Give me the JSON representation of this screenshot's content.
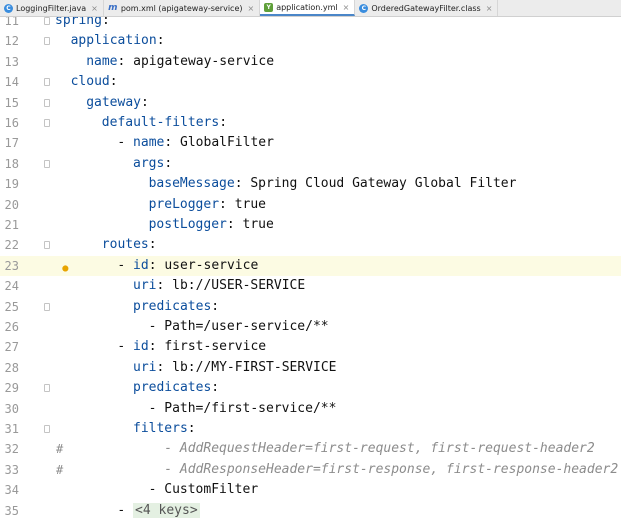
{
  "tabs": [
    {
      "label": "LoggingFilter.java",
      "icon": "java-class-icon",
      "active": false
    },
    {
      "label": "pom.xml (apigateway-service)",
      "icon": "maven-icon",
      "active": false
    },
    {
      "label": "application.yml",
      "icon": "yaml-file-icon",
      "active": true
    },
    {
      "label": "OrderedGatewayFilter.class",
      "icon": "java-class-icon",
      "active": false
    }
  ],
  "tab_close": "×",
  "accent": "#4a86c8",
  "key_color": "#0b4d9c",
  "comment_color": "#8c8c8c",
  "caret_line": 23,
  "lines": [
    {
      "num": "11",
      "indent": 0,
      "key": "spring",
      "sep": ":",
      "val": ""
    },
    {
      "num": "12",
      "indent": 1,
      "key": "application",
      "sep": ":",
      "val": ""
    },
    {
      "num": "13",
      "indent": 2,
      "key": "name",
      "sep": ":",
      "val": " apigateway-service"
    },
    {
      "num": "14",
      "indent": 1,
      "key": "cloud",
      "sep": ":",
      "val": ""
    },
    {
      "num": "15",
      "indent": 2,
      "key": "gateway",
      "sep": ":",
      "val": ""
    },
    {
      "num": "16",
      "indent": 3,
      "key": "default-filters",
      "sep": ":",
      "val": ""
    },
    {
      "num": "17",
      "indent": 4,
      "dash": "- ",
      "key": "name",
      "sep": ":",
      "val": " GlobalFilter"
    },
    {
      "num": "18",
      "indent": 5,
      "key": "args",
      "sep": ":",
      "val": ""
    },
    {
      "num": "19",
      "indent": 6,
      "key": "baseMessage",
      "sep": ":",
      "val": " Spring Cloud Gateway Global Filter"
    },
    {
      "num": "20",
      "indent": 6,
      "key": "preLogger",
      "sep": ":",
      "val": " true"
    },
    {
      "num": "21",
      "indent": 6,
      "key": "postLogger",
      "sep": ":",
      "val": " true"
    },
    {
      "num": "22",
      "indent": 3,
      "key": "routes",
      "sep": ":",
      "val": ""
    },
    {
      "num": "23",
      "indent": 4,
      "dash": "- ",
      "key": "id",
      "sep": ":",
      "val": " user-service"
    },
    {
      "num": "24",
      "indent": 5,
      "key": "uri",
      "sep": ":",
      "val": " lb://USER-SERVICE"
    },
    {
      "num": "25",
      "indent": 5,
      "key": "predicates",
      "sep": ":",
      "val": ""
    },
    {
      "num": "26",
      "indent": 6,
      "plain": "- Path=/user-service/**"
    },
    {
      "num": "27",
      "indent": 4,
      "dash": "- ",
      "key": "id",
      "sep": ":",
      "val": " first-service"
    },
    {
      "num": "28",
      "indent": 5,
      "key": "uri",
      "sep": ":",
      "val": " lb://MY-FIRST-SERVICE"
    },
    {
      "num": "29",
      "indent": 5,
      "key": "predicates",
      "sep": ":",
      "val": ""
    },
    {
      "num": "30",
      "indent": 6,
      "plain": "- Path=/first-service/**"
    },
    {
      "num": "31",
      "indent": 5,
      "key": "filters",
      "sep": ":",
      "val": ""
    },
    {
      "num": "32",
      "indent": 6,
      "hash": "#",
      "comment": "  - AddRequestHeader=first-request, first-request-header2"
    },
    {
      "num": "33",
      "indent": 6,
      "hash": "#",
      "comment": "  - AddResponseHeader=first-response, first-response-header2"
    },
    {
      "num": "34",
      "indent": 6,
      "plain": "- CustomFilter"
    },
    {
      "num": "35",
      "indent": 4,
      "dash": "- ",
      "collapsed": "<4 keys>"
    }
  ]
}
